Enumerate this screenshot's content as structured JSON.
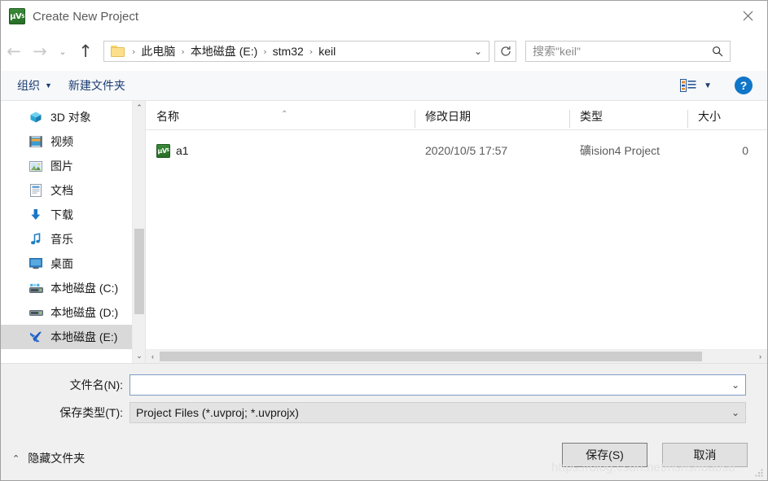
{
  "window": {
    "title": "Create New Project",
    "app_icon": "keil-uvision-icon",
    "close_label": "✕"
  },
  "nav": {
    "back": "←",
    "forward": "→",
    "recent": "⌄",
    "up": "↑",
    "refresh": "↻",
    "dropdown": "⌄"
  },
  "address": {
    "folder_icon": "folder-icon",
    "separator": "›",
    "crumbs": [
      "此电脑",
      "本地磁盘 (E:)",
      "stm32",
      "keil"
    ]
  },
  "search": {
    "placeholder": "搜索\"keil\"",
    "icon": "search-icon"
  },
  "toolbar": {
    "organize_label": "组织",
    "organize_caret": "▼",
    "new_folder_label": "新建文件夹",
    "view_caret": "▼",
    "help_label": "?"
  },
  "sidebar": {
    "items": [
      {
        "label": "3D 对象",
        "icon": "3d-objects-icon",
        "selected": false
      },
      {
        "label": "视频",
        "icon": "videos-icon",
        "selected": false
      },
      {
        "label": "图片",
        "icon": "pictures-icon",
        "selected": false
      },
      {
        "label": "文档",
        "icon": "documents-icon",
        "selected": false
      },
      {
        "label": "下载",
        "icon": "downloads-icon",
        "selected": false
      },
      {
        "label": "音乐",
        "icon": "music-icon",
        "selected": false
      },
      {
        "label": "桌面",
        "icon": "desktop-icon",
        "selected": false
      },
      {
        "label": "本地磁盘 (C:)",
        "icon": "system-drive-icon",
        "selected": false
      },
      {
        "label": "本地磁盘 (D:)",
        "icon": "drive-icon",
        "selected": false
      },
      {
        "label": "本地磁盘 (E:)",
        "icon": "network-drive-icon",
        "selected": true
      }
    ],
    "scroll_up": "⌃",
    "scroll_down": "⌄"
  },
  "filelist": {
    "columns": [
      {
        "label": "名称"
      },
      {
        "label": "修改日期"
      },
      {
        "label": "类型"
      },
      {
        "label": "大小"
      }
    ],
    "sort_mark": "⌃",
    "rows": [
      {
        "name": "a1",
        "icon": "keil-uvision-icon",
        "date": "2020/10/5 17:57",
        "type": "礦ision4 Project",
        "size": "0"
      }
    ],
    "scroll_left": "‹",
    "scroll_right": "›"
  },
  "form": {
    "filename_label": "文件名(N):",
    "filename_value": "",
    "filename_caret": "⌄",
    "filetype_label": "保存类型(T):",
    "filetype_value": "Project Files (*.uvproj; *.uvprojx)",
    "filetype_caret": "⌄",
    "save_label": "保存(S)",
    "cancel_label": "取消",
    "hide_folders_label": "隐藏文件夹",
    "hide_folders_caret": "⌃"
  },
  "watermark": {
    "text": "https://blog.csdn.net/nsnsnbabsb"
  },
  "colors": {
    "accent_blue": "#1076c8",
    "toolbar_text": "#1b3d73",
    "selection": "#d9d9d9",
    "keil_green": "#2f7a2f",
    "dialog_bg": "#f0f0f0"
  }
}
